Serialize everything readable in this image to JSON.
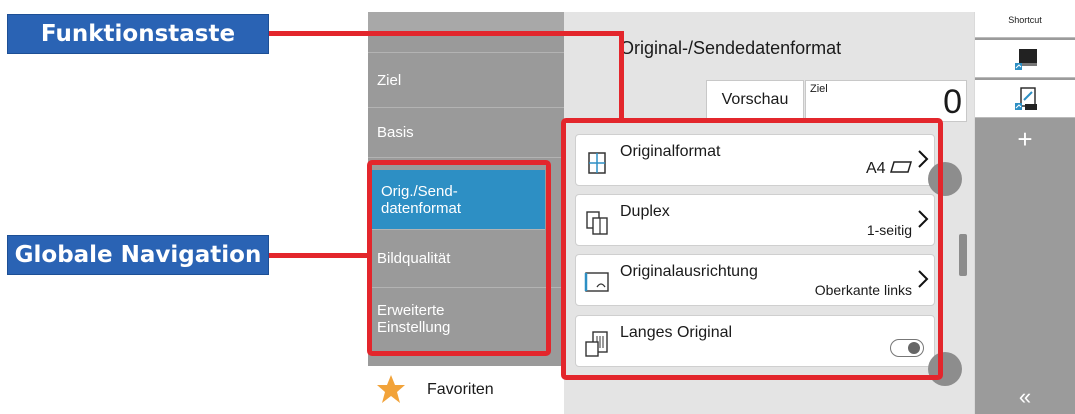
{
  "callouts": {
    "function_key": "Funktionstaste",
    "global_navigation": "Globale Navigation"
  },
  "sidebar": {
    "items": [
      {
        "label": "Ziel"
      },
      {
        "label": "Basis"
      },
      {
        "label": "Orig./Send-\ndatenformat",
        "active": true
      },
      {
        "label": "Bildqualität"
      },
      {
        "label": "Erweiterte\nEinstellung"
      }
    ],
    "favorites": {
      "label": "Favoriten",
      "icon": "star-icon"
    }
  },
  "main": {
    "title": "Original-/Sendedatenformat",
    "preview_tab": "Vorschau",
    "destination_label": "Ziel",
    "destination_count": "0",
    "settings": [
      {
        "title": "Originalformat",
        "value": "A4",
        "icon": "original-size-icon"
      },
      {
        "title": "Duplex",
        "value": "1-seitig",
        "icon": "duplex-icon"
      },
      {
        "title": "Originalausrichtung",
        "value": "Oberkante links",
        "icon": "orientation-icon"
      },
      {
        "title": "Langes Original",
        "value": "",
        "toggle": false,
        "icon": "long-original-icon"
      }
    ]
  },
  "shortcut": {
    "header": "Shortcut",
    "add": "+",
    "collapse": "«"
  },
  "colors": {
    "highlight": "#e3262c",
    "callout_bg": "#2a63b4",
    "active_nav": "#2d8fc4",
    "sidebar_bg": "#9a9a9a"
  }
}
